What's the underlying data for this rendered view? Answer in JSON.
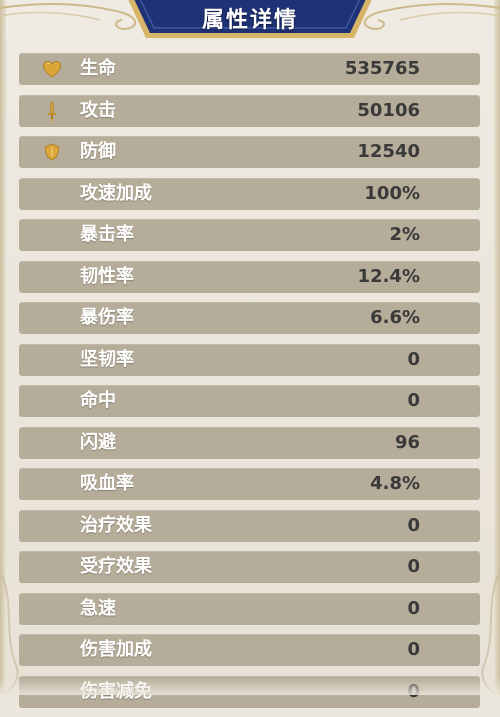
{
  "panel": {
    "title": "属性详情"
  },
  "colors": {
    "banner": "#1f3275",
    "banner_border": "#d6b468",
    "row_bg": "#b5ac99",
    "label": "#ffffff",
    "value": "#3a3a3a",
    "icon_gold": "#d9a637"
  },
  "stats": [
    {
      "label": "生命",
      "value": "535765",
      "icon": "heart-icon"
    },
    {
      "label": "攻击",
      "value": "50106",
      "icon": "sword-icon"
    },
    {
      "label": "防御",
      "value": "12540",
      "icon": "shield-icon"
    },
    {
      "label": "攻速加成",
      "value": "100%"
    },
    {
      "label": "暴击率",
      "value": "2%"
    },
    {
      "label": "韧性率",
      "value": "12.4%"
    },
    {
      "label": "暴伤率",
      "value": "6.6%"
    },
    {
      "label": "坚韧率",
      "value": "0"
    },
    {
      "label": "命中",
      "value": "0"
    },
    {
      "label": "闪避",
      "value": "96"
    },
    {
      "label": "吸血率",
      "value": "4.8%"
    },
    {
      "label": "治疗效果",
      "value": "0"
    },
    {
      "label": "受疗效果",
      "value": "0"
    },
    {
      "label": "急速",
      "value": "0"
    },
    {
      "label": "伤害加成",
      "value": "0"
    },
    {
      "label": "伤害减免",
      "value": "0"
    }
  ]
}
